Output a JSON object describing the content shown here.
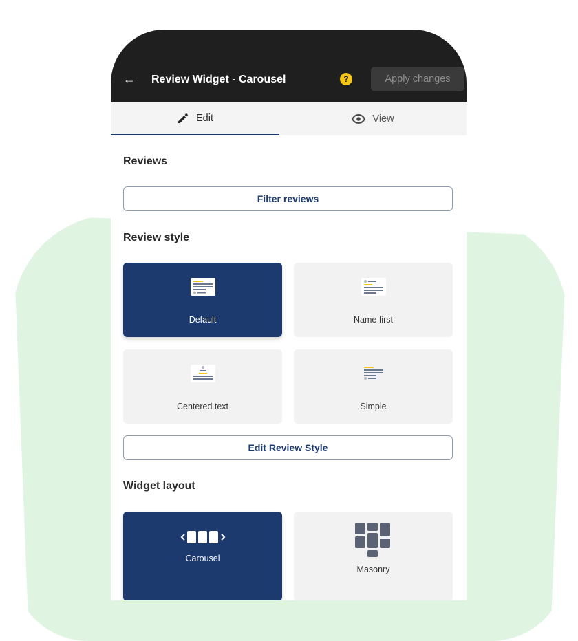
{
  "header": {
    "title": "Review Widget - Carousel",
    "help_glyph": "?",
    "apply_label": "Apply changes"
  },
  "tabs": [
    {
      "label": "Edit",
      "icon": "pencil-icon",
      "active": true
    },
    {
      "label": "View",
      "icon": "eye-icon",
      "active": false
    }
  ],
  "reviews": {
    "heading": "Reviews",
    "filter_label": "Filter reviews"
  },
  "review_style": {
    "heading": "Review style",
    "options": [
      {
        "label": "Default",
        "selected": true
      },
      {
        "label": "Name first",
        "selected": false
      },
      {
        "label": "Centered text",
        "selected": false
      },
      {
        "label": "Simple",
        "selected": false
      }
    ],
    "edit_label": "Edit Review Style"
  },
  "widget_layout": {
    "heading": "Widget layout",
    "options": [
      {
        "label": "Carousel",
        "selected": true
      },
      {
        "label": "Masonry",
        "selected": false
      }
    ]
  },
  "colors": {
    "accent": "#1d3a6e",
    "topbar": "#1f1f1f",
    "star": "#f5c518",
    "background_blob": "#dff5e2"
  }
}
